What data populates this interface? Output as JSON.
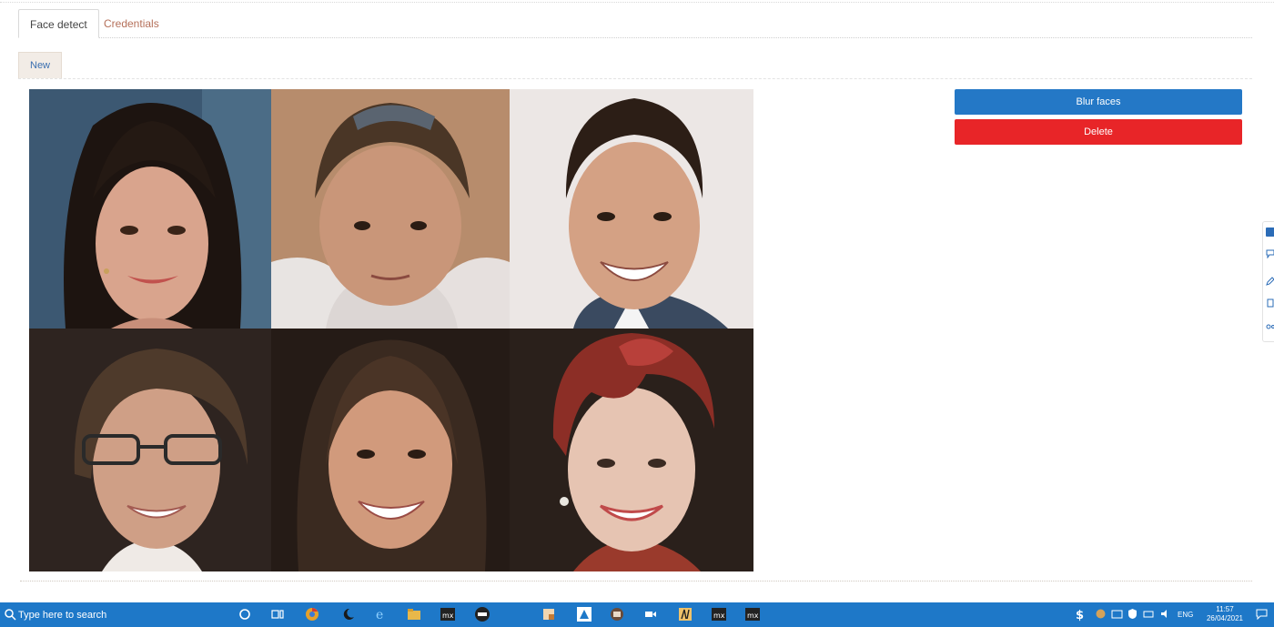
{
  "tabs": [
    {
      "label": "Face detect",
      "active": true
    },
    {
      "label": "Credentials",
      "active": false
    }
  ],
  "toolbar": {
    "new_label": "New"
  },
  "actions": {
    "blur_label": "Blur faces",
    "delete_label": "Delete"
  },
  "colors": {
    "blur": "#2478c6",
    "delete": "#e82528",
    "taskbar": "#1e78c8",
    "tab_link": "#b5705a"
  },
  "gallery": {
    "tiles": [
      {
        "icon": "woman-dark-hair-face"
      },
      {
        "icon": "boy-face"
      },
      {
        "icon": "man-smiling-face"
      },
      {
        "icon": "woman-glasses-face"
      },
      {
        "icon": "woman-long-hair-face"
      },
      {
        "icon": "woman-red-hair-face"
      }
    ]
  },
  "taskbar": {
    "search_placeholder": "Type here to search",
    "language": "ENG",
    "time": "11:57",
    "date": "26/04/2021"
  }
}
